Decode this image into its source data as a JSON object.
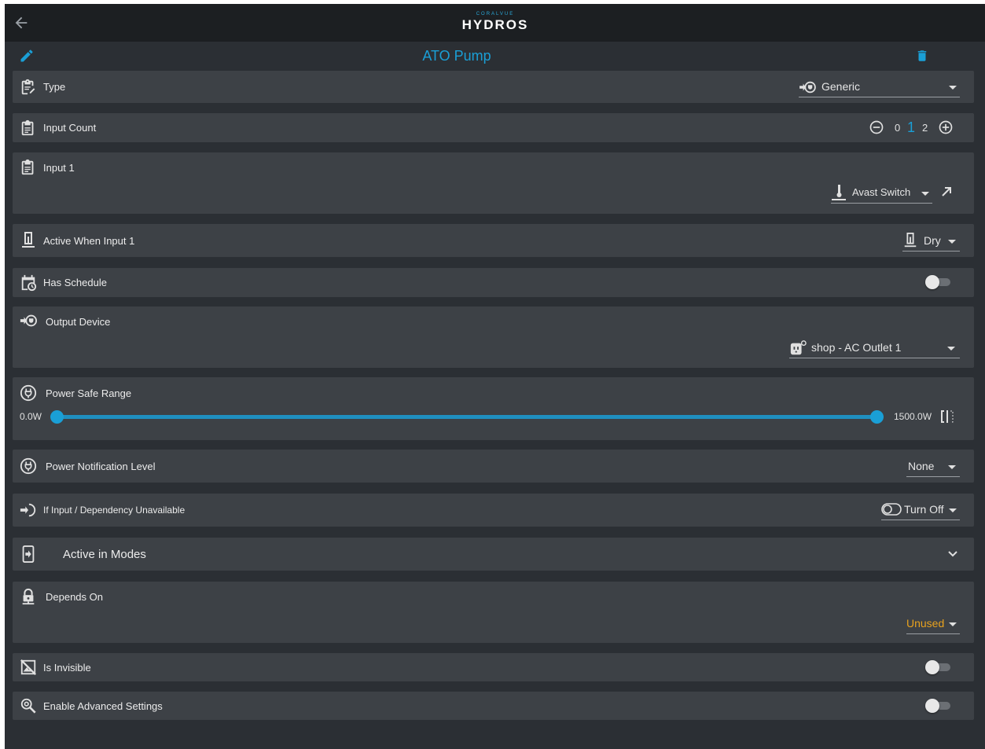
{
  "header": {
    "logo_sub": "CORALVUE",
    "logo_main": "HYDROS"
  },
  "page": {
    "title": "ATO Pump"
  },
  "rows": {
    "type": {
      "label": "Type",
      "value": "Generic"
    },
    "input_count": {
      "label": "Input Count",
      "options": [
        "0",
        "1",
        "2"
      ],
      "selected": "1"
    },
    "input1": {
      "label": "Input 1",
      "value": "Avast Switch"
    },
    "active_when": {
      "label": "Active When Input 1",
      "value": "Dry"
    },
    "has_schedule": {
      "label": "Has Schedule",
      "on": false
    },
    "output_device": {
      "label": "Output Device",
      "value": "shop - AC Outlet 1"
    },
    "power_safe_range": {
      "label": "Power Safe Range",
      "min_label": "0.0W",
      "max_label": "1500.0W",
      "low": 0,
      "high": 1
    },
    "power_notification": {
      "label": "Power Notification Level",
      "value": "None"
    },
    "if_unavailable": {
      "label": "If Input / Dependency Unavailable",
      "value": "Turn Off"
    },
    "active_in_modes": {
      "label": "Active in Modes"
    },
    "depends_on": {
      "label": "Depends On",
      "value": "Unused"
    },
    "is_invisible": {
      "label": "Is Invisible",
      "on": false
    },
    "advanced": {
      "label": "Enable Advanced Settings",
      "on": false
    }
  },
  "colors": {
    "accent": "#1a9fd6",
    "warning": "#e8a21e",
    "row_bg": "#3d4146",
    "page_bg": "#2b2f34",
    "topbar_bg": "#1c1f22"
  },
  "icons": {
    "back": "arrow-left-icon",
    "edit": "pencil-icon",
    "delete": "trash-icon",
    "type": "clipboard-edit-icon",
    "input_count": "clipboard-list-icon",
    "input1": "clipboard-list-icon",
    "active_when": "water-level-icon",
    "schedule": "calendar-clock-icon",
    "output": "power-plug-arrow-icon",
    "power": "power-plug-circle-icon",
    "unavailable": "arrow-right-circle-icon",
    "modes": "tablet-login-icon",
    "depends": "lock-icon",
    "invisible": "image-off-icon",
    "advanced": "zoom-cog-icon"
  }
}
